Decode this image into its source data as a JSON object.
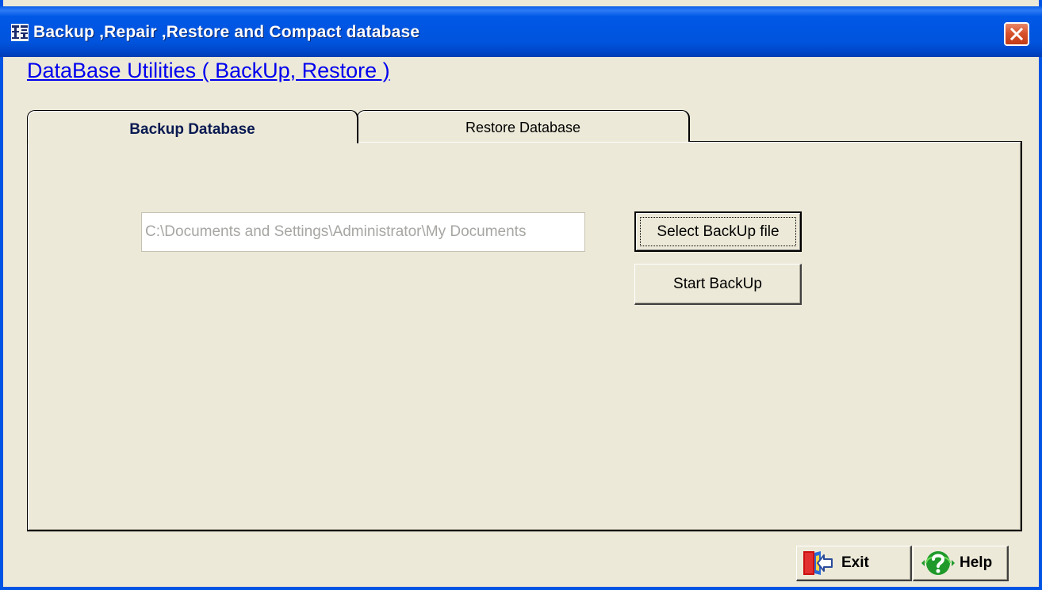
{
  "window": {
    "title": "Backup ,Repair ,Restore and Compact database",
    "app_icon": "database-utility-icon",
    "close_icon": "close-icon"
  },
  "header": {
    "subtitle": "DataBase Utilities ( BackUp, Restore )"
  },
  "tabs": [
    {
      "label": "Backup Database",
      "active": true
    },
    {
      "label": "Restore Database",
      "active": false
    }
  ],
  "backup": {
    "path_value": "C:\\Documents and Settings\\Administrator\\My Documents",
    "select_button_label": "Select BackUp file",
    "start_button_label": "Start BackUp"
  },
  "footer": {
    "exit_label": "Exit",
    "exit_icon": "exit-door-icon",
    "help_label": "Help",
    "help_icon": "help-question-icon"
  },
  "colors": {
    "titlebar": "#0054E3",
    "window_bg": "#ECE9D8",
    "link": "#0000EE",
    "close_button": "#D8532D"
  }
}
